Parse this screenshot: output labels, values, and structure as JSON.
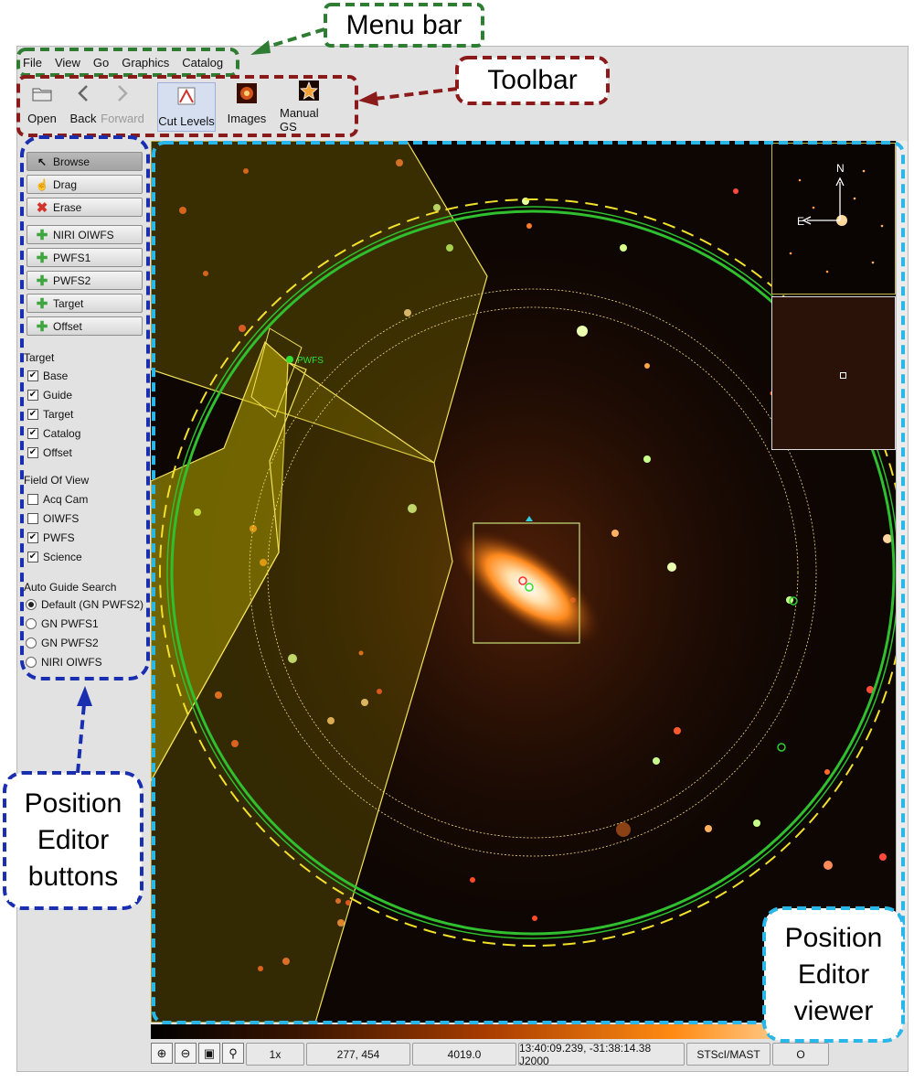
{
  "menu": [
    "File",
    "View",
    "Go",
    "Graphics",
    "Catalog"
  ],
  "toolbar": [
    {
      "label": "Open",
      "icon": "folder-icon"
    },
    {
      "label": "Back",
      "icon": "chevron-left-icon"
    },
    {
      "label": "Forward",
      "icon": "chevron-right-icon",
      "disabled": true
    },
    {
      "label": "Cut Levels",
      "icon": "cut-levels-icon",
      "active": true
    },
    {
      "label": "Images",
      "icon": "images-icon"
    },
    {
      "label": "Manual GS",
      "icon": "manual-gs-icon"
    }
  ],
  "position_editor": {
    "buttons": [
      {
        "label": "Browse",
        "icon": "arrow-cursor-icon",
        "selected": true
      },
      {
        "label": "Drag",
        "icon": "hand-icon"
      },
      {
        "label": "Erase",
        "icon": "erase-icon"
      },
      {
        "label": "NIRI OIWFS",
        "icon": "plus-icon"
      },
      {
        "label": "PWFS1",
        "icon": "plus-icon"
      },
      {
        "label": "PWFS2",
        "icon": "plus-icon"
      },
      {
        "label": "Target",
        "icon": "plus-icon"
      },
      {
        "label": "Offset",
        "icon": "plus-icon"
      }
    ],
    "target_section": "Target",
    "target_items": [
      {
        "label": "Base",
        "checked": true
      },
      {
        "label": "Guide",
        "checked": true
      },
      {
        "label": "Target",
        "checked": true
      },
      {
        "label": "Catalog",
        "checked": true
      },
      {
        "label": "Offset",
        "checked": true
      }
    ],
    "fov_section": "Field Of View",
    "fov_items": [
      {
        "label": "Acq Cam",
        "checked": false
      },
      {
        "label": "OIWFS",
        "checked": false
      },
      {
        "label": "PWFS",
        "checked": true
      },
      {
        "label": "Science",
        "checked": true
      }
    ],
    "guide_section": "Auto Guide Search",
    "guide_items": [
      {
        "label": "Default (GN PWFS2)",
        "selected": true
      },
      {
        "label": "GN PWFS1",
        "selected": false
      },
      {
        "label": "GN PWFS2",
        "selected": false
      },
      {
        "label": "NIRI OIWFS",
        "selected": false
      }
    ]
  },
  "viewer": {
    "compass_n": "N",
    "compass_e": "E",
    "pwfs_label": "PWFS"
  },
  "statusbar": {
    "zoom": "1x",
    "pixel": "277, 454",
    "value": "4019.0",
    "coords": "13:40:09.239, -31:38:14.38 J2000",
    "source": "STScI/MAST",
    "extra": "O"
  },
  "callouts": {
    "menu_bar": "Menu bar",
    "toolbar": "Toolbar",
    "buttons": [
      "Position",
      "Editor",
      "buttons"
    ],
    "viewer": [
      "Position",
      "Editor",
      "viewer"
    ]
  },
  "colors": {
    "menu_callout": "#2e7d32",
    "toolbar_callout": "#8b1a1a",
    "buttons_callout": "#1a2fb0",
    "viewer_callout": "#29b6e8"
  }
}
